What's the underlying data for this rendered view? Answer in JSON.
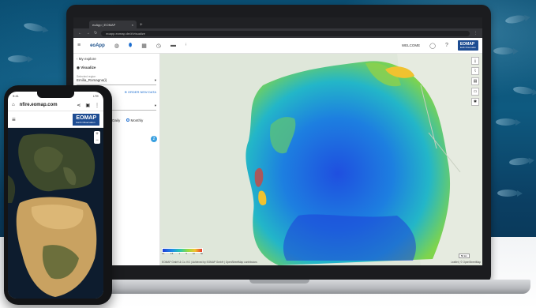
{
  "laptop": {
    "browser": {
      "tab_title": "eoApp | EOMAP",
      "tab_close": "×",
      "new_tab": "+",
      "url": "eoapp.eomap.de/#/visualize"
    },
    "header": {
      "app_name": "eoApp",
      "welcome": "WELCOME",
      "logo": "EOMAP",
      "logo_sub": "Earth Observation"
    },
    "panel": {
      "back_link": "My explore",
      "section": "Visualize",
      "region_label": "Selected region",
      "region_value": "Emilia_Romagna(i)",
      "order_button": "ORDER NEW DATA",
      "radio_daily": "Daily",
      "radio_monthly": "Monthly",
      "badge": "2"
    },
    "map": {
      "attribution": "EOMAP GmbH & Co. KG | Achieved by EOMAP GmbH | OpenStreetMap contributors",
      "attribution_right": "Leaflet | © OpenStreetMap",
      "scale": "50 km",
      "colorbar_ticks": [
        "0.1",
        "0.5",
        "1",
        "5",
        "10",
        "50"
      ]
    }
  },
  "phone": {
    "status_time": "9:41",
    "status_right": "LTE",
    "url": "nfire.eomap.com",
    "logo": "EOMAP",
    "logo_sub": "Earth Observation",
    "zoom_in": "+",
    "zoom_out": "−"
  },
  "colors": {
    "brand": "#1d4c92",
    "accent": "#1a6ccf"
  }
}
